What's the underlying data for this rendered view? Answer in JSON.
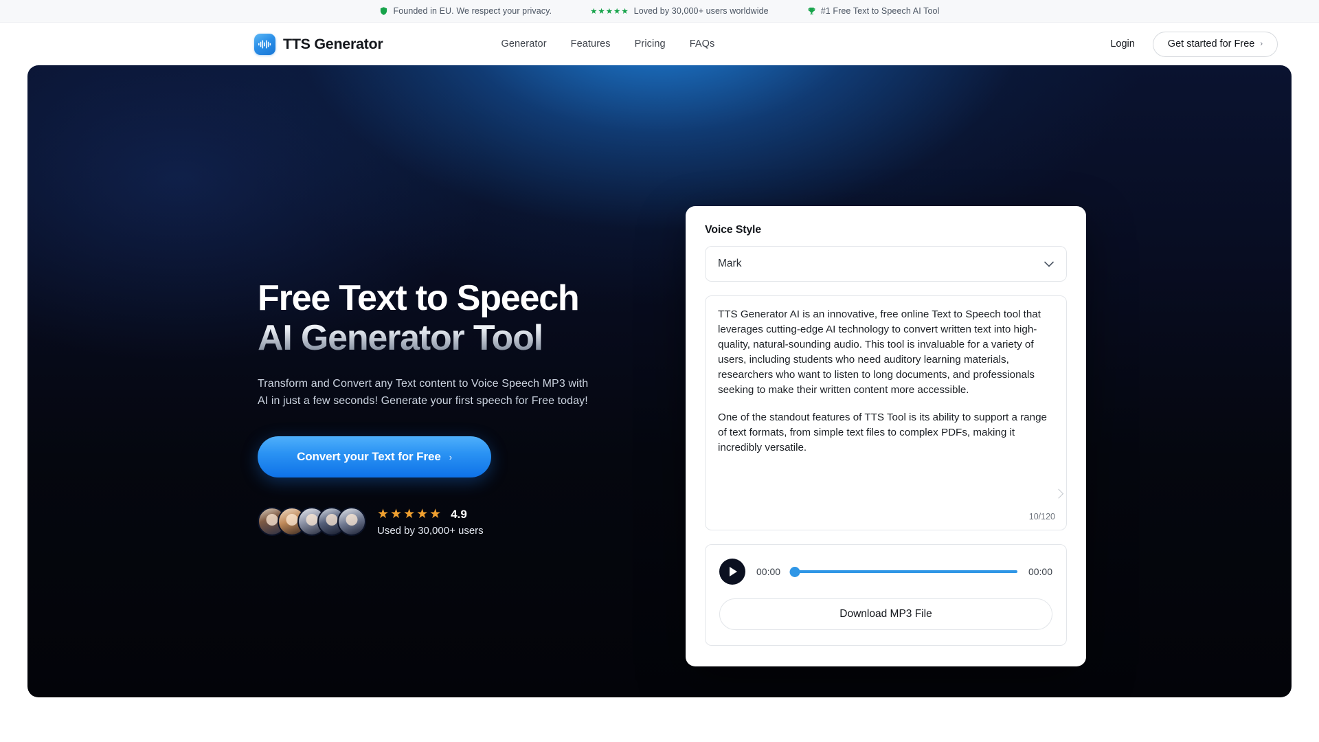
{
  "announcement": {
    "items": [
      {
        "icon": "shield-icon",
        "text": "Founded in EU. We respect your privacy."
      },
      {
        "icon": "stars-icon",
        "stars": "★★★★★",
        "text": "Loved by 30,000+ users worldwide"
      },
      {
        "icon": "trophy-icon",
        "text": "#1 Free Text to Speech AI Tool"
      }
    ]
  },
  "header": {
    "brand": "TTS Generator",
    "nav": [
      {
        "label": "Generator"
      },
      {
        "label": "Features"
      },
      {
        "label": "Pricing"
      },
      {
        "label": "FAQs"
      }
    ],
    "login_label": "Login",
    "cta_label": "Get started for Free",
    "cta_chevron": "›"
  },
  "hero": {
    "heading_line1": "Free Text to Speech",
    "heading_line2": "AI Generator Tool",
    "subtitle_line1": "Transform and Convert any Text content to Voice Speech MP3 with",
    "subtitle_line2": "AI in just a few seconds! Generate your first speech for Free today!",
    "cta_label": "Convert your Text for Free",
    "cta_chevron": "›",
    "social_proof": {
      "stars": "★★★★★",
      "score": "4.9",
      "used_by": "Used by 30,000+ users",
      "avatar_count": 5
    }
  },
  "card": {
    "voice_style_label": "Voice Style",
    "voice_selected": "Mark",
    "chevron_down": "⌄",
    "text_paragraphs": [
      "TTS Generator AI is an innovative, free online Text to Speech  tool that leverages cutting-edge AI technology to convert written text into high-quality, natural-sounding audio. This tool is invaluable for a variety of users, including students who need auditory learning materials, researchers who want to listen to long documents, and professionals seeking to make their written content more accessible.",
      "One of the standout features of TTS Tool is its ability to support a range of text formats, from simple text files to complex PDFs, making it incredibly versatile."
    ],
    "counter": "10/120",
    "player": {
      "current_time": "00:00",
      "total_time": "00:00",
      "progress_percent": 1.5
    },
    "download_label": "Download MP3 File"
  },
  "colors": {
    "accent_blue": "#2f96e6",
    "green": "#16a34a",
    "gold": "#f0a030",
    "hero_dark": "#05070f"
  }
}
